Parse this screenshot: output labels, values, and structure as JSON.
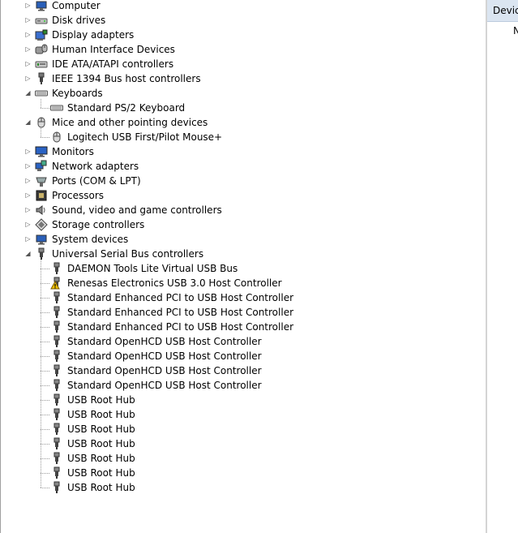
{
  "tree": [
    {
      "label": "Computer",
      "icon": "computer-icon",
      "state": "collapsed",
      "children": []
    },
    {
      "label": "Disk drives",
      "icon": "disk-drive-icon",
      "state": "collapsed",
      "children": []
    },
    {
      "label": "Display adapters",
      "icon": "display-adapter-icon",
      "state": "collapsed",
      "children": []
    },
    {
      "label": "Human Interface Devices",
      "icon": "hid-icon",
      "state": "collapsed",
      "children": []
    },
    {
      "label": "IDE ATA/ATAPI controllers",
      "icon": "ide-controller-icon",
      "state": "collapsed",
      "children": []
    },
    {
      "label": "IEEE 1394 Bus host controllers",
      "icon": "ieee1394-icon",
      "state": "collapsed",
      "children": []
    },
    {
      "label": "Keyboards",
      "icon": "keyboard-icon",
      "state": "expanded",
      "children": [
        {
          "label": "Standard PS/2 Keyboard",
          "icon": "keyboard-icon"
        }
      ]
    },
    {
      "label": "Mice and other pointing devices",
      "icon": "mouse-icon",
      "state": "expanded",
      "children": [
        {
          "label": "Logitech USB First/Pilot Mouse+",
          "icon": "mouse-icon"
        }
      ]
    },
    {
      "label": "Monitors",
      "icon": "monitor-icon",
      "state": "collapsed",
      "children": []
    },
    {
      "label": "Network adapters",
      "icon": "network-adapter-icon",
      "state": "collapsed",
      "children": []
    },
    {
      "label": "Ports (COM & LPT)",
      "icon": "port-icon",
      "state": "collapsed",
      "children": []
    },
    {
      "label": "Processors",
      "icon": "processor-icon",
      "state": "collapsed",
      "children": []
    },
    {
      "label": "Sound, video and game controllers",
      "icon": "speaker-icon",
      "state": "collapsed",
      "children": []
    },
    {
      "label": "Storage controllers",
      "icon": "storage-controller-icon",
      "state": "collapsed",
      "children": []
    },
    {
      "label": "System devices",
      "icon": "computer-icon",
      "state": "collapsed",
      "children": []
    },
    {
      "label": "Universal Serial Bus controllers",
      "icon": "usb-icon",
      "state": "expanded",
      "children": [
        {
          "label": "DAEMON Tools Lite Virtual USB Bus",
          "icon": "usb-icon"
        },
        {
          "label": "Renesas Electronics USB 3.0 Host Controller",
          "icon": "usb-warning-icon"
        },
        {
          "label": "Standard Enhanced PCI to USB Host Controller",
          "icon": "usb-icon"
        },
        {
          "label": "Standard Enhanced PCI to USB Host Controller",
          "icon": "usb-icon"
        },
        {
          "label": "Standard Enhanced PCI to USB Host Controller",
          "icon": "usb-icon"
        },
        {
          "label": "Standard OpenHCD USB Host Controller",
          "icon": "usb-icon"
        },
        {
          "label": "Standard OpenHCD USB Host Controller",
          "icon": "usb-icon"
        },
        {
          "label": "Standard OpenHCD USB Host Controller",
          "icon": "usb-icon"
        },
        {
          "label": "Standard OpenHCD USB Host Controller",
          "icon": "usb-icon"
        },
        {
          "label": "USB Root Hub",
          "icon": "usb-icon"
        },
        {
          "label": "USB Root Hub",
          "icon": "usb-icon"
        },
        {
          "label": "USB Root Hub",
          "icon": "usb-icon"
        },
        {
          "label": "USB Root Hub",
          "icon": "usb-icon"
        },
        {
          "label": "USB Root Hub",
          "icon": "usb-icon"
        },
        {
          "label": "USB Root Hub",
          "icon": "usb-icon"
        },
        {
          "label": "USB Root Hub",
          "icon": "usb-icon"
        }
      ]
    }
  ],
  "right_panel": {
    "header_label": "Devic",
    "item_label": "N"
  },
  "colors": {
    "header_bg": "#dbe5f1",
    "warning": "#f2c200"
  }
}
